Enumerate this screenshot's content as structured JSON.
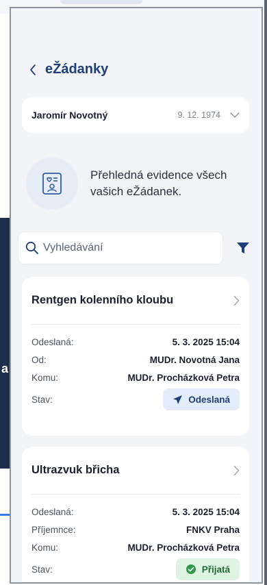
{
  "header": {
    "back_label": "eŽádanky"
  },
  "patient": {
    "name": "Jaromír Novotný",
    "dob": "9. 12. 1974"
  },
  "intro": {
    "text": "Přehledná evidence všech vašich eŽádanek."
  },
  "search": {
    "placeholder": "Vyhledávání"
  },
  "background": {
    "fragment_text": "a"
  },
  "requests": [
    {
      "title": "Rentgen kolenního kloubu",
      "rows": [
        {
          "label": "Odeslaná:",
          "value": "5. 3. 2025 15:04"
        },
        {
          "label": "Od:",
          "value": "MUDr. Novotná Jana"
        },
        {
          "label": "Komu:",
          "value": "MUDr. Procházková Petra"
        }
      ],
      "status_label": "Stav:",
      "status": "Odeslaná"
    },
    {
      "title": "Ultrazvuk břicha",
      "rows": [
        {
          "label": "Odeslaná:",
          "value": "5. 3. 2025 15:04"
        },
        {
          "label": "Příjemnce:",
          "value": "FNKV Praha"
        },
        {
          "label": "Komu:",
          "value": "MUDr. Procházková Petra"
        }
      ],
      "status_label": "Stav:",
      "status": "Přijatá"
    }
  ],
  "colors": {
    "accent": "#1e3f77",
    "screen_bg": "#f3f4f8",
    "status_sent_bg": "#e3ecf8",
    "status_accepted_bg": "#dff3e3",
    "status_accepted_icon": "#2f9a4a"
  },
  "icons": {
    "back": "chevron-left-icon",
    "patient_expand": "chevron-down-icon",
    "intro": "id-card-icon",
    "search": "search-icon",
    "filter": "filter-icon",
    "open_request": "chevron-right-icon",
    "status_sent": "send-icon",
    "status_accepted": "check-circle-icon"
  }
}
